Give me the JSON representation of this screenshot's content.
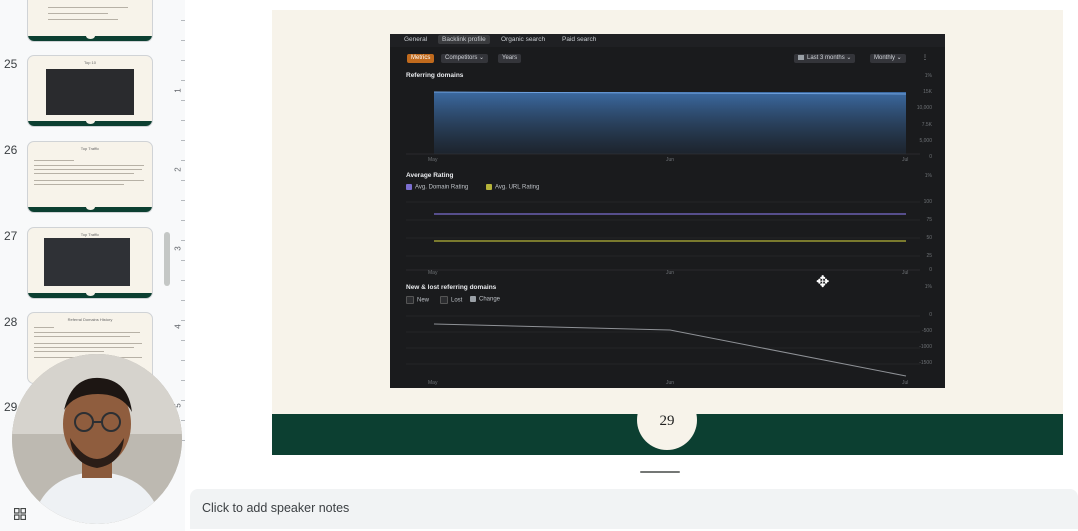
{
  "sidebar": {
    "slides": [
      {
        "number": "25",
        "title": "Top 10"
      },
      {
        "number": "26",
        "title": "Top Traffic"
      },
      {
        "number": "27",
        "title": "Top Traffic"
      },
      {
        "number": "28",
        "title": "Referral Domains History"
      },
      {
        "number": "29",
        "title": ""
      }
    ]
  },
  "ruler": {
    "labels": [
      "1",
      "2",
      "3",
      "4",
      "5"
    ]
  },
  "slide": {
    "page_number": "29",
    "screenshot": {
      "tabs": [
        "General",
        "Backlink profile",
        "Organic search",
        "Paid search"
      ],
      "toolbar": {
        "metrics": "Metrics",
        "competitors": "Competitors ⌄",
        "years": "Years",
        "date_range": "Last 3 months ⌄",
        "interval": "Monthly ⌄",
        "more": "⋮"
      },
      "sections": {
        "referring_domains": {
          "title": "Referring domains",
          "x_labels": [
            "May",
            "Jun",
            "Jul"
          ],
          "y_labels": [
            "1%",
            "15K",
            "10,000",
            "7.5K",
            "5,000",
            "0"
          ]
        },
        "average_rating": {
          "title": "Average Rating",
          "legend": [
            "Avg. Domain Rating",
            "Avg. URL Rating"
          ],
          "x_labels": [
            "May",
            "Jun",
            "Jul"
          ],
          "y_labels": [
            "1%",
            "100",
            "75",
            "50",
            "25",
            "0"
          ]
        },
        "new_lost": {
          "title": "New & lost referring domains",
          "legend": [
            "New",
            "Lost",
            "Change"
          ],
          "x_labels": [
            "May",
            "Jun",
            "Jul"
          ],
          "y_labels": [
            "1%",
            "0",
            "-500",
            "-1000",
            "-1500"
          ]
        }
      }
    }
  },
  "notes": {
    "placeholder": "Click to add speaker notes"
  },
  "colors": {
    "brand_green": "#0c3f31",
    "slide_cream": "#f7f3ea",
    "selection_blue": "#1a73e8",
    "chart_blue": "#3d6ea8",
    "domain_rating": "#7b6ed0",
    "url_rating": "#b5b33a"
  }
}
